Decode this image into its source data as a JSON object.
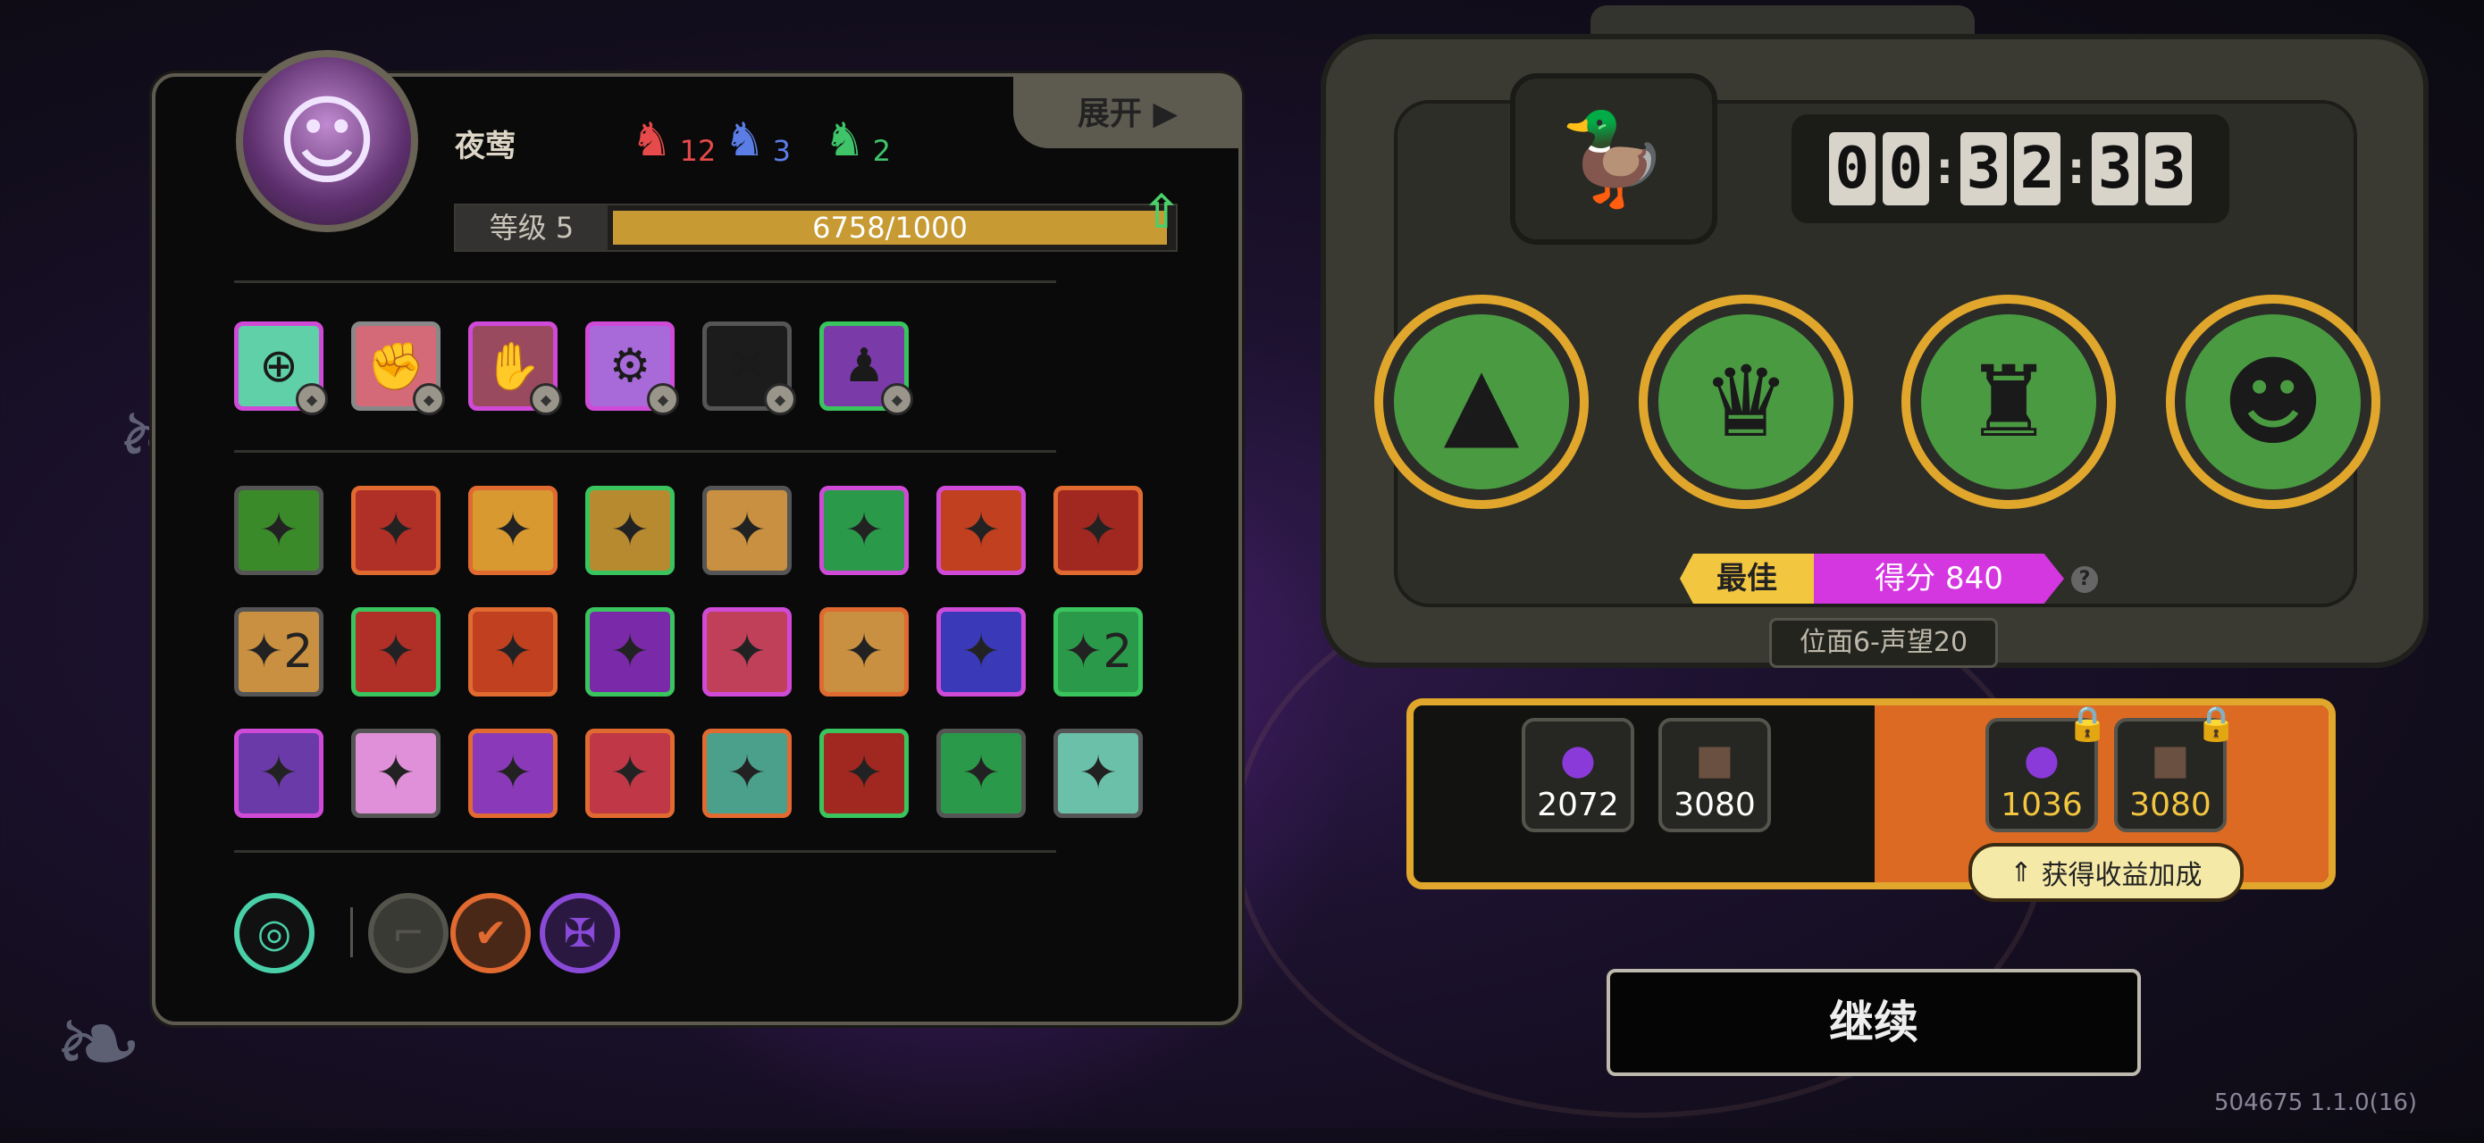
{
  "character": {
    "name": "夜莺",
    "avatar_icon": "white-haired-girl-portrait",
    "level_label": "等级 5",
    "exp_text": "6758/1000",
    "exp_progress": 1.0,
    "masks": [
      {
        "icon": "red-mask-icon",
        "count": "12",
        "color": "#e64a4a"
      },
      {
        "icon": "blue-mask-icon",
        "count": "3",
        "color": "#5b7de6"
      },
      {
        "icon": "green-mask-icon",
        "count": "2",
        "color": "#3fc46a"
      }
    ],
    "expand_label": "展开 ▶"
  },
  "equipment_slots": [
    {
      "icon": "crosshair-icon",
      "color": "#5fd0a8",
      "border": "#d04ad8"
    },
    {
      "icon": "punch-icon",
      "color": "#d46a78",
      "border": "#888"
    },
    {
      "icon": "claw-icon",
      "color": "#9a4a5e",
      "border": "#d04ad8"
    },
    {
      "icon": "gear-eye-icon",
      "color": "#a86ad8",
      "border": "#d04ad8"
    },
    {
      "icon": "empty-slot-icon",
      "color": "#1c1c1c",
      "border": "#555"
    },
    {
      "icon": "summon-figure-icon",
      "color": "#7a3aa8",
      "border": "#3ac45e"
    }
  ],
  "traits": [
    {
      "icon": "leaf-crest-icon",
      "bg": "#3a8a2a",
      "border": "#555",
      "level": ""
    },
    {
      "icon": "bite-icon",
      "bg": "#b03028",
      "border": "#e06a30",
      "level": ""
    },
    {
      "icon": "crystal-burst-icon",
      "bg": "#d89a30",
      "border": "#e06a30",
      "level": ""
    },
    {
      "icon": "rock-spike-icon",
      "bg": "#b88a30",
      "border": "#3ac45e",
      "level": ""
    },
    {
      "icon": "arrow-tower-icon",
      "bg": "#c89040",
      "border": "#555",
      "level": ""
    },
    {
      "icon": "green-slash-icon",
      "bg": "#2a9a4a",
      "border": "#d04ad8",
      "level": ""
    },
    {
      "icon": "lightning-strike-icon",
      "bg": "#c04020",
      "border": "#d04ad8",
      "level": ""
    },
    {
      "icon": "bullets-icon",
      "bg": "#a02820",
      "border": "#e06a30",
      "level": ""
    },
    {
      "icon": "explosion-icon",
      "bg": "#c89040",
      "border": "#555",
      "level": "2"
    },
    {
      "icon": "crossed-blades-icon",
      "bg": "#b03028",
      "border": "#3ac45e",
      "level": ""
    },
    {
      "icon": "crown-shield-icon",
      "bg": "#c04020",
      "border": "#e06a30",
      "level": ""
    },
    {
      "icon": "dash-arrow-icon",
      "bg": "#7a2aa8",
      "border": "#3ac45e",
      "level": ""
    },
    {
      "icon": "grab-hand-icon",
      "bg": "#c0405a",
      "border": "#d04ad8",
      "level": ""
    },
    {
      "icon": "beast-head-icon",
      "bg": "#c89040",
      "border": "#e06a30",
      "level": ""
    },
    {
      "icon": "cross-target-icon",
      "bg": "#3a3ab8",
      "border": "#d04ad8",
      "level": ""
    },
    {
      "icon": "green-shard-icon",
      "bg": "#2a9a4a",
      "border": "#3ac45e",
      "level": "2"
    },
    {
      "icon": "turret-icon",
      "bg": "#6a3aa8",
      "border": "#d04ad8",
      "level": ""
    },
    {
      "icon": "feather-blade-icon",
      "bg": "#e090d8",
      "border": "#555",
      "level": ""
    },
    {
      "icon": "up-arrow-icon",
      "bg": "#8a3ab8",
      "border": "#e06a30",
      "level": ""
    },
    {
      "icon": "fist-shock-icon",
      "bg": "#c03848",
      "border": "#e06a30",
      "level": ""
    },
    {
      "icon": "ammo-belt-icon",
      "bg": "#4aa08a",
      "border": "#e06a30",
      "level": ""
    },
    {
      "icon": "shadow-beast-icon",
      "bg": "#a02820",
      "border": "#3ac45e",
      "level": ""
    },
    {
      "icon": "grass-burst-icon",
      "bg": "#2a9a4a",
      "border": "#555",
      "level": ""
    },
    {
      "icon": "arrow-cloak-icon",
      "bg": "#6ac0a8",
      "border": "#555",
      "level": ""
    }
  ],
  "bottom_icons": [
    {
      "icon": "tape-roll-icon",
      "ring": "#4ad0a8",
      "bg": "#111"
    },
    {
      "icon": "pistol-icon",
      "ring": "#55544c",
      "bg": "#3a3a34"
    },
    {
      "icon": "check-badge-icon",
      "ring": "#e06a30",
      "bg": "#4a2818"
    },
    {
      "icon": "winged-sword-icon",
      "ring": "#8a4ad8",
      "bg": "#2a1840"
    }
  ],
  "run": {
    "boss_icon": "crowned-duck-icon",
    "timer": [
      "0",
      "0",
      "3",
      "2",
      "3",
      "3"
    ],
    "heroes": [
      {
        "icon": "hooded-assassin-icon"
      },
      {
        "icon": "horned-beast-icon"
      },
      {
        "icon": "armored-knight-icon"
      },
      {
        "icon": "afro-glasses-guy-icon"
      }
    ],
    "best_label": "最佳",
    "score_label": "得分 840",
    "help_label": "?",
    "plane_label": "位面6-声望20"
  },
  "rewards": {
    "base": [
      {
        "icon": "purple-orb-icon",
        "value": "2072",
        "color": "#8a3ad8"
      },
      {
        "icon": "book-icon",
        "value": "3080",
        "color": "#6a5040"
      }
    ],
    "bonus": [
      {
        "icon": "purple-orb-icon",
        "value": "1036",
        "color": "#8a3ad8"
      },
      {
        "icon": "book-icon",
        "value": "3080",
        "color": "#6a5040"
      }
    ],
    "lock_icon": "lock-icon",
    "gain_label": "获得收益加成"
  },
  "continue_label": "继续",
  "version": "504675 1.1.0(16)"
}
